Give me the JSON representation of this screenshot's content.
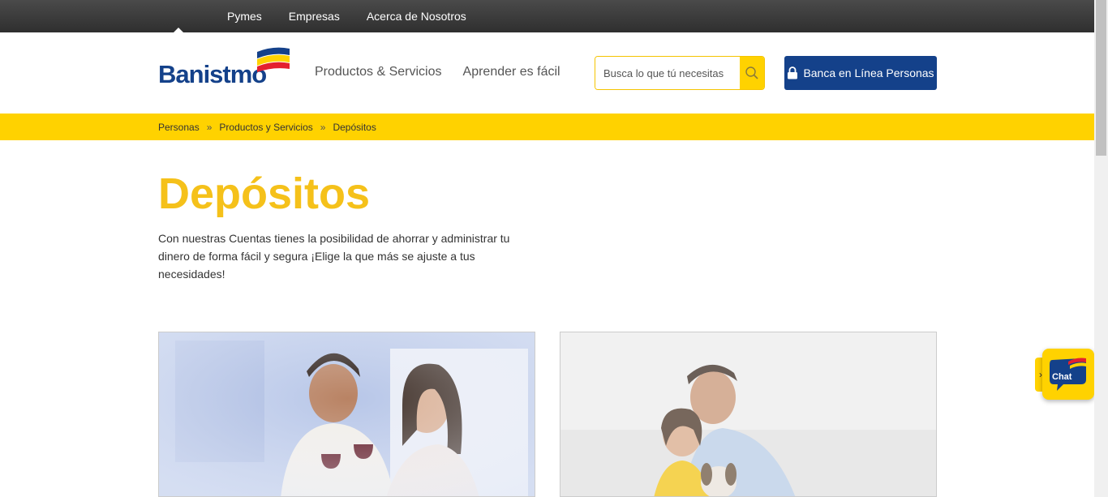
{
  "topbar": {
    "items": [
      "Pymes",
      "Empresas",
      "Acerca de Nosotros"
    ]
  },
  "header": {
    "logo_text": "Banistmo",
    "nav": [
      "Productos & Servicios",
      "Aprender es fácil"
    ],
    "search_placeholder": "Busca lo que tú necesitas",
    "banca_label": "Banca en Línea Personas"
  },
  "breadcrumb": {
    "items": [
      "Personas",
      "Productos y Servicios",
      "Depósitos"
    ],
    "separator": "»"
  },
  "main": {
    "title": "Depósitos",
    "description": "Con nuestras Cuentas tienes la posibilidad de ahorrar y administrar tu dinero de forma fácil y segura ¡Elige la que más se ajuste a tus necesidades!"
  },
  "chat": {
    "label": "Chat",
    "toggle": "›"
  },
  "colors": {
    "brand_blue": "#14418a",
    "brand_yellow": "#ffd200",
    "title_yellow": "#f5c11a",
    "logo_red": "#e4202e"
  }
}
